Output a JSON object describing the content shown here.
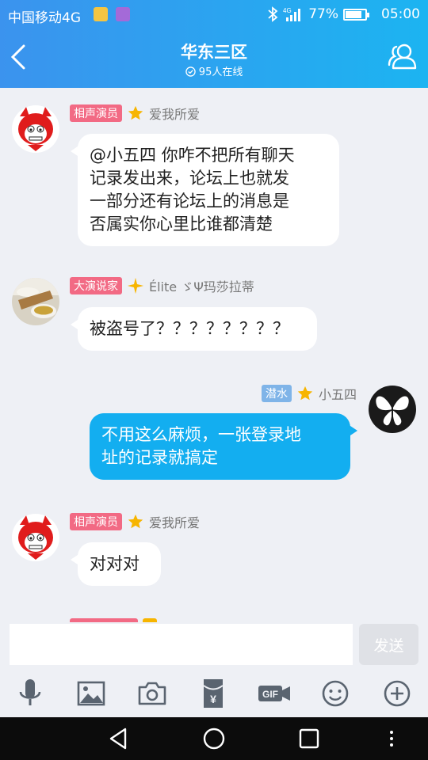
{
  "status_bar": {
    "carrier": "中国移动4G",
    "network": "4G",
    "battery": "77%",
    "battery_level": 0.77,
    "time": "05:00"
  },
  "header": {
    "title": "华东三区",
    "online": "95人在线"
  },
  "messages": [
    {
      "sender": "爱我所爱",
      "badge": "相声演员",
      "badge_color": "#f26a84",
      "text_lines": [
        "@小五四 你咋不把所有聊天",
        "记录发出来，论坛上也就发",
        "一部分还有论坛上的消息是",
        "否属实你心里比谁都清楚"
      ]
    },
    {
      "sender": "Élite ゞΨ玛莎拉蒂",
      "badge": "大演说家",
      "badge_color": "#f26a84",
      "text_lines": [
        "被盗号了？？？？？？？？"
      ]
    },
    {
      "sender": "小五四",
      "badge": "潜水",
      "badge_color": "#7fb4e8",
      "text_lines": [
        "不用这么麻烦，一张登录地",
        "址的记录就搞定"
      ]
    },
    {
      "sender": "爱我所爱",
      "badge": "相声演员",
      "badge_color": "#f26a84",
      "text_lines": [
        "对对对"
      ]
    }
  ],
  "composer": {
    "value": "",
    "send_label": "发送"
  },
  "toolbar_icons": [
    "microphone-icon",
    "image-icon",
    "camera-icon",
    "red-packet-icon",
    "gif-icon",
    "emoji-icon",
    "plus-icon"
  ],
  "nav_icons": [
    "back-triangle-icon",
    "home-circle-icon",
    "recents-square-icon",
    "more-dots-icon"
  ],
  "colors": {
    "header_start": "#3b93ee",
    "header_end": "#1cb4f1",
    "out_bubble": "#13aef0",
    "background": "#eef0f5"
  }
}
